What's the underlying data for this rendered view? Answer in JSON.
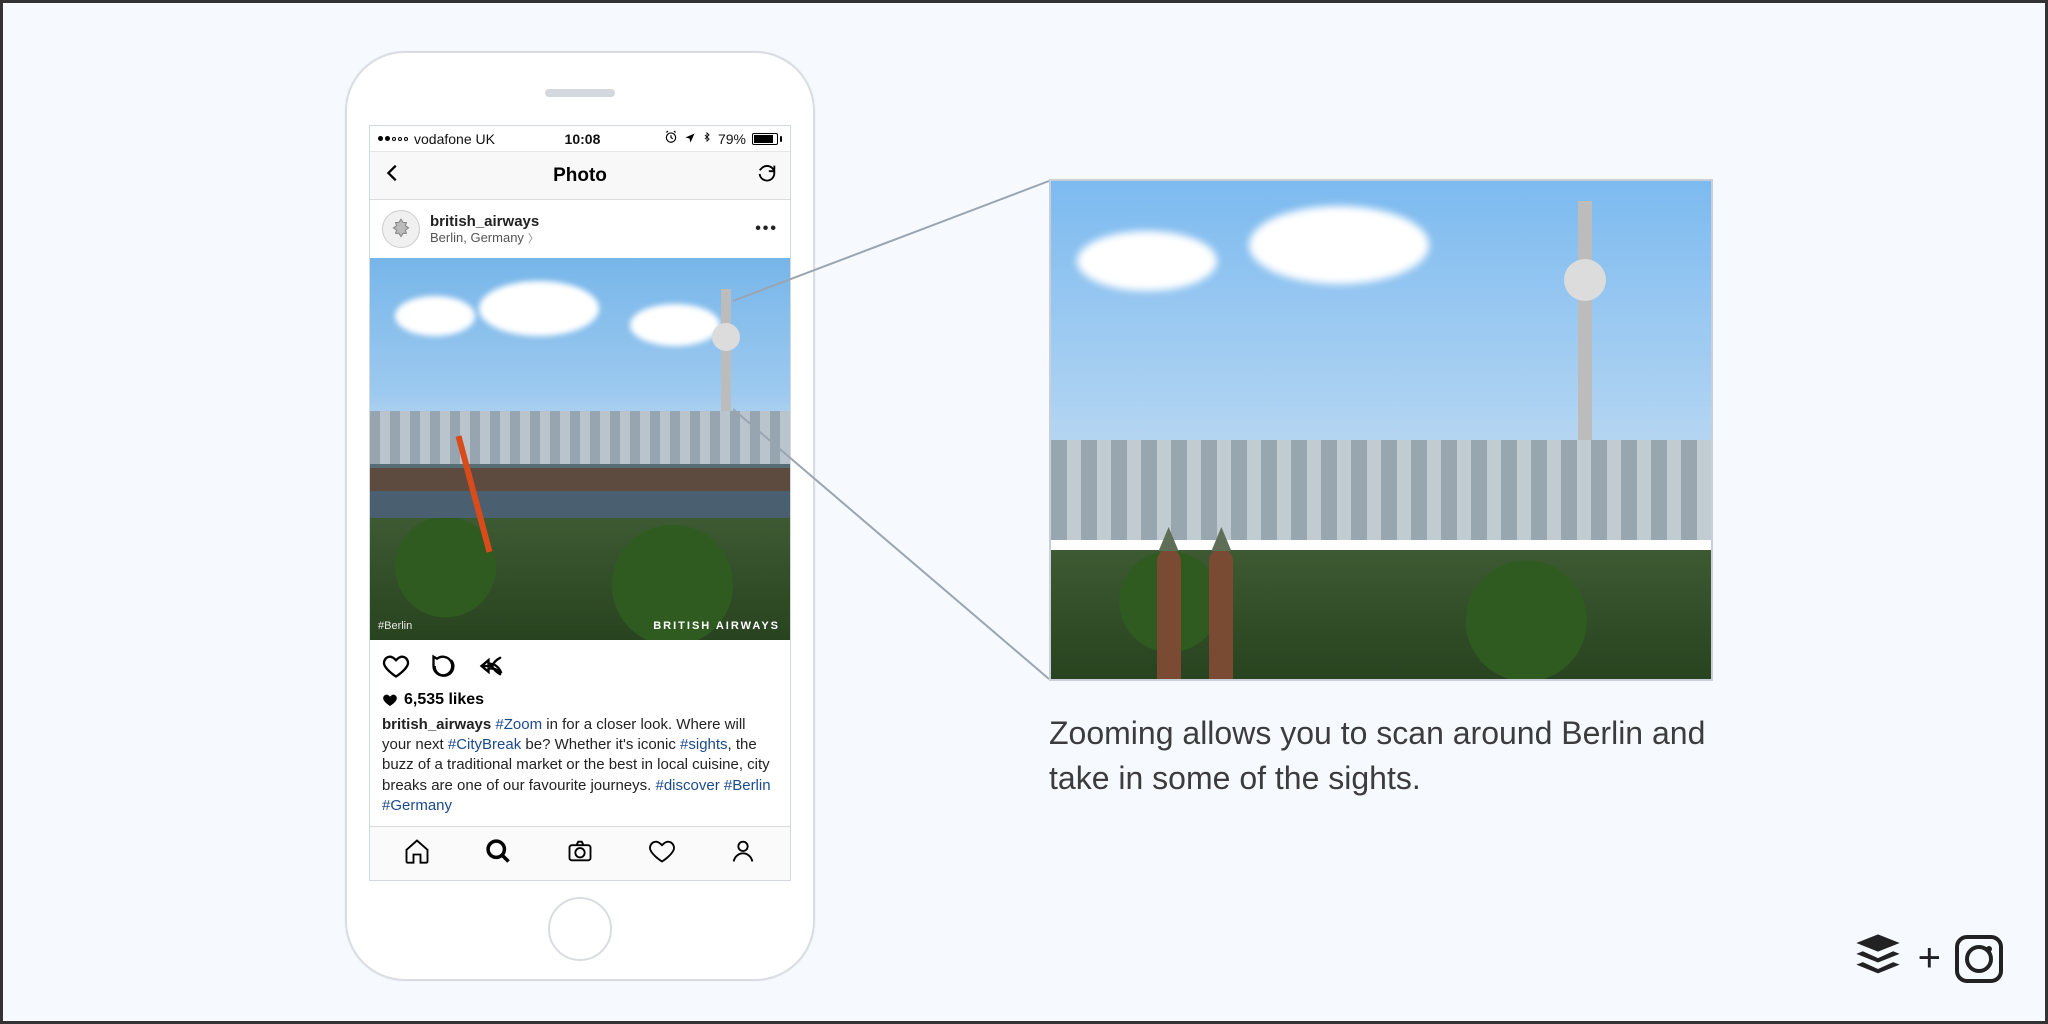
{
  "status": {
    "carrier": "vodafone UK",
    "time": "10:08",
    "battery_pct": "79%"
  },
  "topnav": {
    "title": "Photo"
  },
  "post": {
    "username": "british_airways",
    "location": "Berlin, Germany",
    "watermark": "BRITISH AIRWAYS",
    "hashtag_overlay": "#Berlin",
    "likes_text": "6,535 likes",
    "caption_user": "british_airways",
    "caption_parts": {
      "h1": "#Zoom",
      "t1": " in for a closer look. Where will your next ",
      "h2": "#CityBreak",
      "t2": " be? Whether it's iconic ",
      "h3": "#sights",
      "t3": ", the buzz of a traditional market or the best in local cuisine, city breaks are one of our favourite journeys.  ",
      "h4": "#discover",
      "h5": "#Berlin",
      "h6": "#Germany"
    }
  },
  "zoom": {
    "caption": "Zooming allows you to scan around Berlin and take in some of the sights."
  },
  "brand": {
    "plus": "+"
  }
}
